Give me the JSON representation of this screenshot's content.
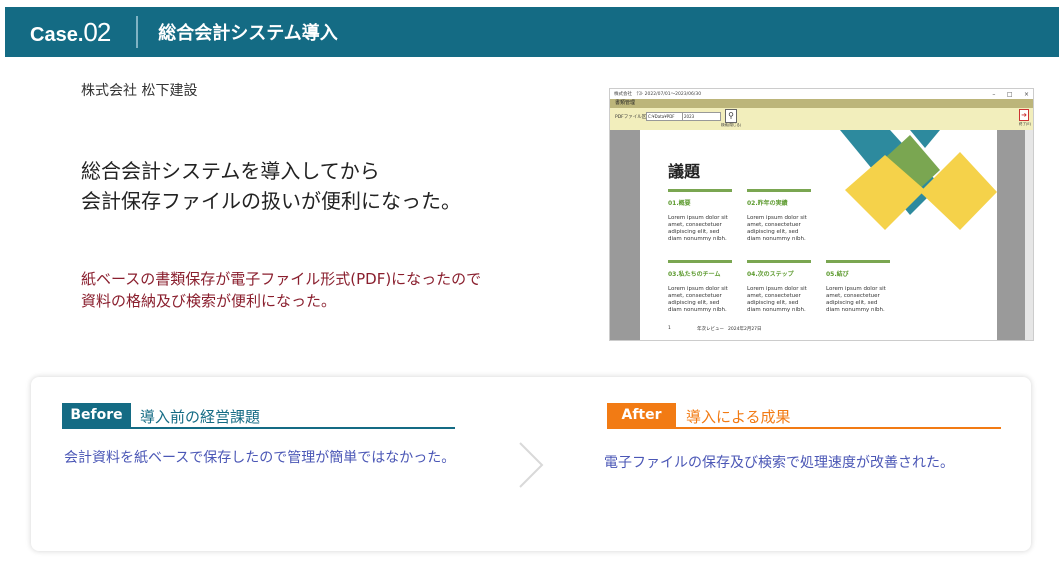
{
  "header": {
    "case_prefix": "Case.",
    "case_number": "02",
    "title": "総合会計システム導入"
  },
  "company": "株式会社 松下建設",
  "headline": {
    "line1": "総合会計システムを導入してから",
    "line2": "会計保存ファイルの扱いが便利になった。"
  },
  "description": {
    "line1": "紙ベースの書類保存が電子ファイル形式(PDF)になったので",
    "line2": "資料の格納及び検索が便利になった。"
  },
  "screenshot": {
    "titlebar": "株式会社　ﾃｽﾄ 2022/07/01〜2023/06/30",
    "window_controls": [
      "–",
      "□",
      "×"
    ],
    "menu": "書類管理",
    "toolbar_label": "PDFファイル区分",
    "select1": "C:¥Data¥PDF",
    "select2": "2023",
    "search_label": "検索(閉じる)",
    "exit_label": "終了(E)",
    "doc": {
      "title": "議題",
      "sections": [
        {
          "heading": "01.概要",
          "body": "Lorem ipsum dolor sit amet, consectetuer adipiscing elit, sed diam nonummy nibh."
        },
        {
          "heading": "02.昨年の実績",
          "body": "Lorem ipsum dolor sit amet, consectetuer adipiscing elit, sed diam nonummy nibh."
        },
        {
          "heading": "03.私たちのチーム",
          "body": "Lorem ipsum dolor sit amet, consectetuer adipiscing elit, sed diam nonummy nibh."
        },
        {
          "heading": "04.次のステップ",
          "body": "Lorem ipsum dolor sit amet, consectetuer adipiscing elit, sed diam nonummy nibh."
        },
        {
          "heading": "05.結び",
          "body": "Lorem ipsum dolor sit amet, consectetuer adipiscing elit, sed diam nonummy nibh."
        }
      ],
      "footer_page": "1",
      "footer_title": "年次レビュー",
      "footer_date": "2024年2月27日"
    }
  },
  "before": {
    "tag": "Before",
    "title": "導入前の経営課題",
    "text": "会計資料を紙ベースで保存したので管理が簡単ではなかった。"
  },
  "after": {
    "tag": "After",
    "title": "導入による成果",
    "text": "電子ファイルの保存及び検索で処理速度が改善された。"
  },
  "colors": {
    "brand": "#146b84",
    "accent": "#f27b14",
    "highlight_text": "#8a1f2e",
    "body_link": "#4b57b6"
  }
}
